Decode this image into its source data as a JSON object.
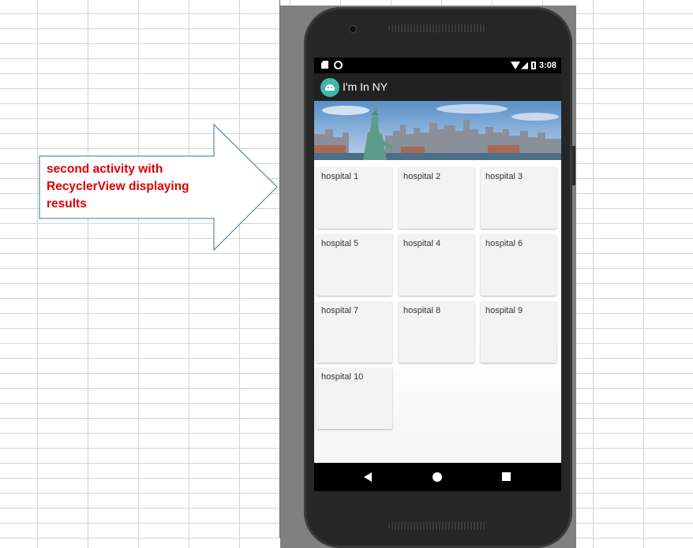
{
  "callout": {
    "text": "second activity with RecyclerView displaying results"
  },
  "status_bar": {
    "time": "3:08",
    "icons": [
      "sd-card-icon",
      "circle-icon",
      "wifi-icon",
      "signal-icon",
      "battery-icon"
    ]
  },
  "toolbar": {
    "app_icon": "android-icon",
    "title": "I'm In NY"
  },
  "banner": {
    "image": "statue-of-liberty-skyline"
  },
  "hospitals": [
    "hospital 1",
    "hospital 2",
    "hospital 3",
    "hospital 5",
    "hospital 4",
    "hospital 6",
    "hospital 7",
    "hospital 8",
    "hospital 9",
    "hospital 10"
  ],
  "nav_bar": {
    "icons": [
      "back-icon",
      "home-icon",
      "recents-icon"
    ]
  }
}
